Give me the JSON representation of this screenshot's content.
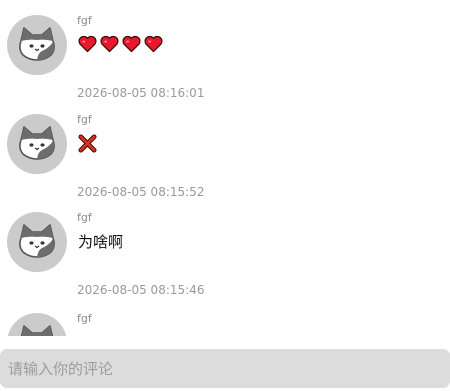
{
  "comments": [
    {
      "username": "fgf",
      "content": "",
      "content_type": "emoji",
      "emojis": [
        "heart-icon",
        "heart-icon",
        "heart-icon",
        "heart-icon"
      ],
      "timestamp": "2026-08-05 08:16:01"
    },
    {
      "username": "fgf",
      "content": "",
      "content_type": "emoji",
      "emojis": [
        "cross-mark-icon"
      ],
      "timestamp": "2026-08-05 08:15:52"
    },
    {
      "username": "fgf",
      "content": "为啥啊",
      "content_type": "text",
      "timestamp": "2026-08-05 08:15:46"
    },
    {
      "username": "fgf",
      "content": "",
      "content_type": "text",
      "timestamp": ""
    }
  ],
  "input": {
    "placeholder": "请输入你的评论",
    "value": ""
  },
  "colors": {
    "avatar_bg": "#cbcbcb",
    "input_bg": "#dcdcdc",
    "heart": "#e8192c",
    "cross": "#c62a1e",
    "username": "#8b8b8b",
    "timestamp": "#9a9a9a"
  }
}
